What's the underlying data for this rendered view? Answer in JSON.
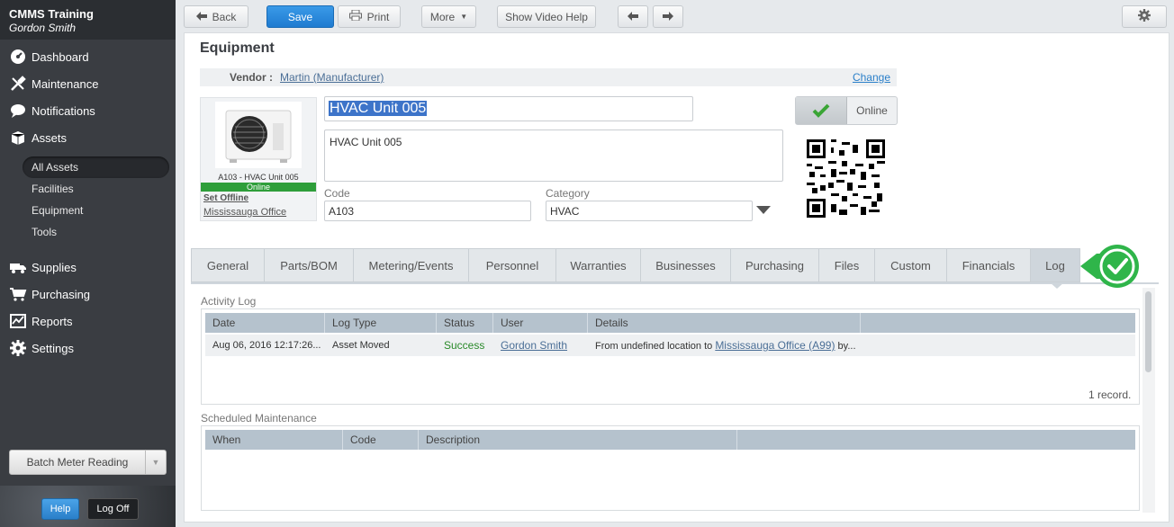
{
  "app": {
    "org": "CMMS Training",
    "user": "Gordon Smith"
  },
  "sidebar": {
    "items": [
      {
        "label": "Dashboard",
        "icon": "dashboard-icon"
      },
      {
        "label": "Maintenance",
        "icon": "tools-icon"
      },
      {
        "label": "Notifications",
        "icon": "chat-bubble-icon"
      },
      {
        "label": "Assets",
        "icon": "boxes-icon"
      }
    ],
    "assets_sub": [
      "All Assets",
      "Facilities",
      "Equipment",
      "Tools"
    ],
    "items2": [
      {
        "label": "Supplies",
        "icon": "truck-icon"
      },
      {
        "label": "Purchasing",
        "icon": "cart-icon"
      },
      {
        "label": "Reports",
        "icon": "chart-icon"
      },
      {
        "label": "Settings",
        "icon": "gear-icon"
      }
    ],
    "batch_label": "Batch Meter Reading",
    "help_label": "Help",
    "logoff_label": "Log Off"
  },
  "toolbar": {
    "back": "Back",
    "save": "Save",
    "print": "Print",
    "more": "More",
    "video_help": "Show Video Help"
  },
  "page": {
    "title": "Equipment",
    "vendor_key": "Vendor :",
    "vendor_value": "Martin (Manufacturer)",
    "change": "Change",
    "thumb_caption": "A103 - HVAC Unit 005",
    "thumb_status": "Online",
    "set_offline": "Set Offline",
    "location": "Mississauga Office",
    "name": "HVAC Unit 005",
    "description": "HVAC Unit 005",
    "code_label": "Code",
    "code_value": "A103",
    "category_label": "Category",
    "category_value": "HVAC",
    "online_label": "Online"
  },
  "tabs": [
    "General",
    "Parts/BOM",
    "Metering/Events",
    "Personnel",
    "Warranties",
    "Businesses",
    "Purchasing",
    "Files",
    "Custom",
    "Financials",
    "Log"
  ],
  "activity": {
    "title": "Activity Log",
    "columns": [
      "Date",
      "Log Type",
      "Status",
      "User",
      "Details"
    ],
    "row": {
      "date": "Aug 06, 2016 12:17:26...",
      "type": "Asset Moved",
      "status": "Success",
      "user": "Gordon Smith",
      "details_prefix": "From undefined location to",
      "details_link": "Mississauga Office (A99)",
      "details_suffix": "by..."
    },
    "records": "1 record."
  },
  "scheduled": {
    "title": "Scheduled Maintenance",
    "columns": [
      "When",
      "Code",
      "Description"
    ]
  },
  "colors": {
    "accent": "#1f7bd0",
    "online_green": "#2e9e3a",
    "badge_green": "#2fb54a"
  }
}
